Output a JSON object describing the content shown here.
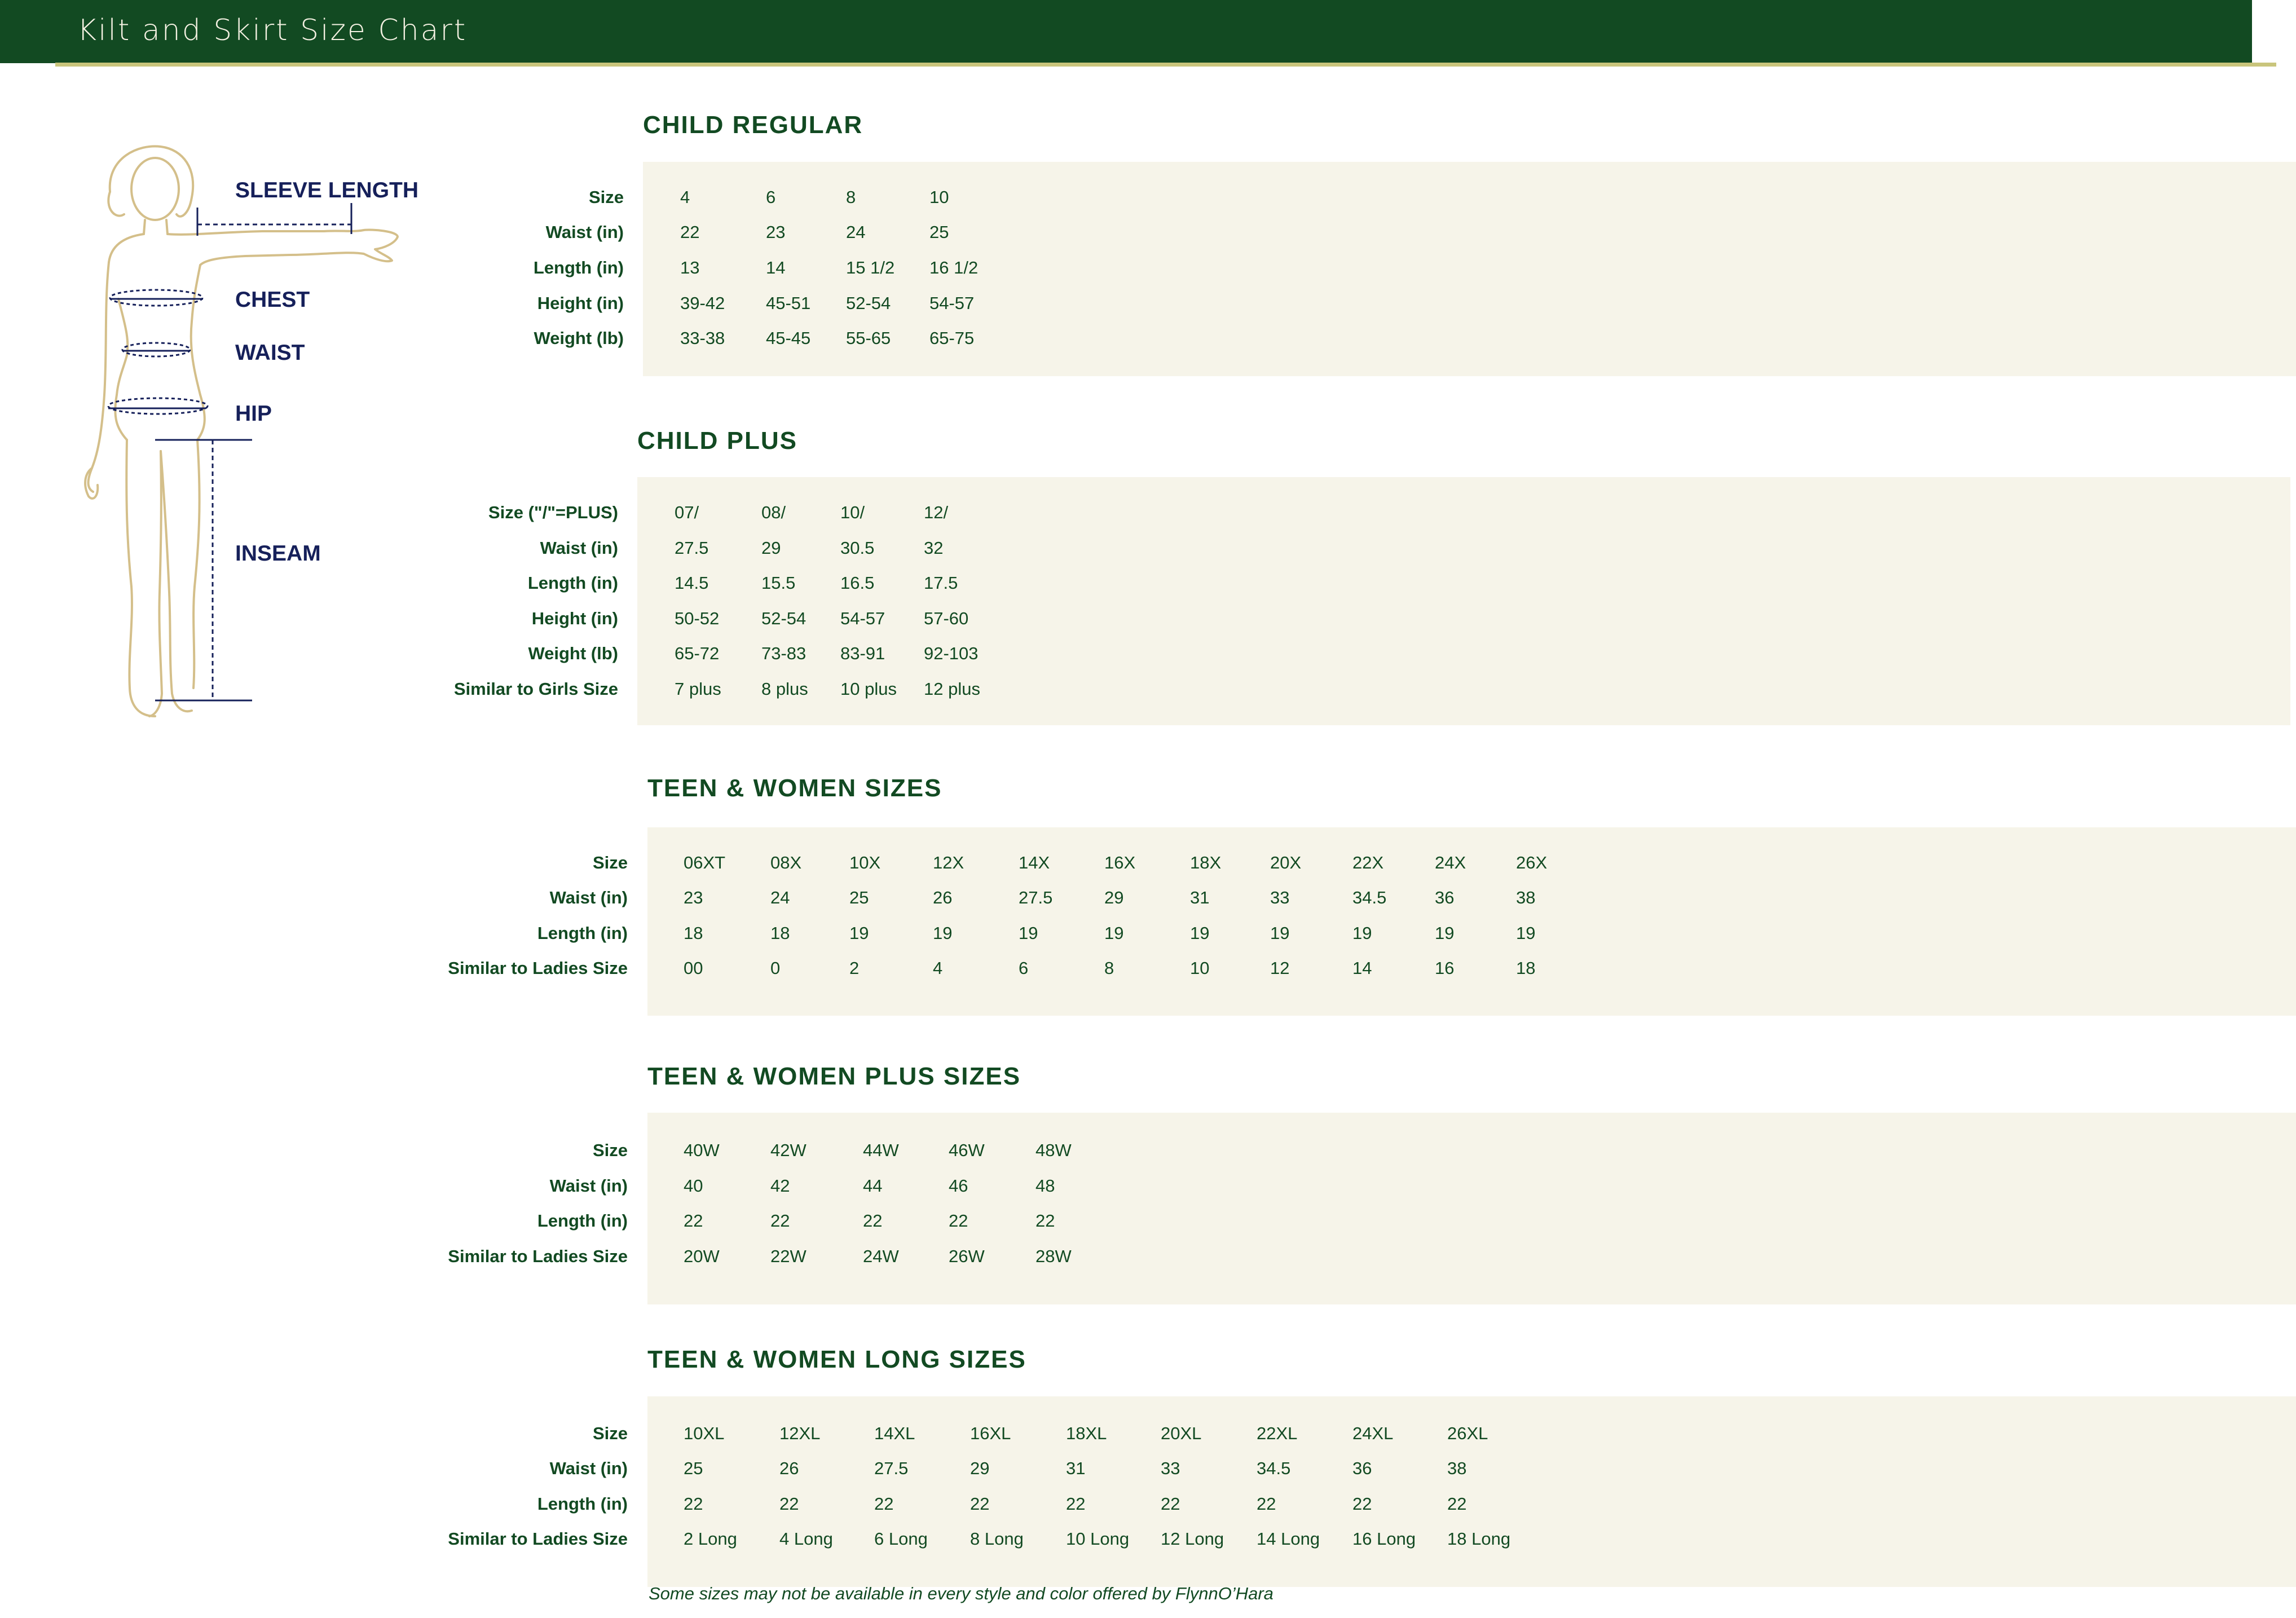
{
  "header": {
    "title": "Kilt and Skirt Size Chart"
  },
  "figure": {
    "labels": {
      "sleeve": "SLEEVE LENGTH",
      "chest": "CHEST",
      "waist": "WAIST",
      "hip": "HIP",
      "inseam": "INSEAM"
    }
  },
  "sections": [
    {
      "title": "CHILD  REGULAR",
      "rows": [
        {
          "label": "Size",
          "values": [
            "4",
            "6",
            "8",
            "10"
          ]
        },
        {
          "label": "Waist (in)",
          "values": [
            "22",
            "23",
            "24",
            "25"
          ]
        },
        {
          "label": "Length (in)",
          "values": [
            "13",
            "14",
            "15 1/2",
            "16 1/2"
          ]
        },
        {
          "label": "Height (in)",
          "values": [
            "39-42",
            "45-51",
            "52-54",
            "54-57"
          ]
        },
        {
          "label": "Weight (lb)",
          "values": [
            "33-38",
            "45-45",
            "55-65",
            "65-75"
          ]
        }
      ]
    },
    {
      "title": "CHILD PLUS",
      "rows": [
        {
          "label": "Size (\"/\"=PLUS)",
          "values": [
            "07/",
            "08/",
            "10/",
            "12/"
          ]
        },
        {
          "label": "Waist (in)",
          "values": [
            "27.5",
            "29",
            "30.5",
            "32"
          ]
        },
        {
          "label": "Length (in)",
          "values": [
            "14.5",
            "15.5",
            "16.5",
            "17.5"
          ]
        },
        {
          "label": "Height (in)",
          "values": [
            "50-52",
            "52-54",
            "54-57",
            "57-60"
          ]
        },
        {
          "label": "Weight (lb)",
          "values": [
            "65-72",
            "73-83",
            "83-91",
            "92-103"
          ]
        },
        {
          "label": "Similar to Girls Size",
          "values": [
            "7 plus",
            "8 plus",
            "10 plus",
            "12 plus"
          ]
        }
      ]
    },
    {
      "title": "TEEN & WOMEN SIZES",
      "rows": [
        {
          "label": "Size",
          "values": [
            "06XT",
            "08X",
            "10X",
            "12X",
            "14X",
            "16X",
            "18X",
            "20X",
            "22X",
            "24X",
            "26X"
          ]
        },
        {
          "label": "Waist (in)",
          "values": [
            "23",
            "24",
            "25",
            "26",
            "27.5",
            "29",
            "31",
            "33",
            "34.5",
            "36",
            "38"
          ]
        },
        {
          "label": "Length (in)",
          "values": [
            "18",
            "18",
            "19",
            "19",
            "19",
            "19",
            "19",
            "19",
            "19",
            "19",
            "19"
          ]
        },
        {
          "label": "Similar to Ladies Size",
          "values": [
            "00",
            "0",
            "2",
            "4",
            "6",
            "8",
            "10",
            "12",
            "14",
            "16",
            "18"
          ]
        }
      ]
    },
    {
      "title": "TEEN & WOMEN PLUS SIZES",
      "rows": [
        {
          "label": "Size",
          "values": [
            "40W",
            "42W",
            "44W",
            "46W",
            "48W"
          ]
        },
        {
          "label": "Waist (in)",
          "values": [
            "40",
            "42",
            "44",
            "46",
            "48"
          ]
        },
        {
          "label": "Length (in)",
          "values": [
            "22",
            "22",
            "22",
            "22",
            "22"
          ]
        },
        {
          "label": "Similar to Ladies Size",
          "values": [
            "20W",
            "22W",
            "24W",
            "26W",
            "28W"
          ]
        }
      ]
    },
    {
      "title": "TEEN & WOMEN LONG SIZES",
      "rows": [
        {
          "label": "Size",
          "values": [
            "10XL",
            "12XL",
            "14XL",
            "16XL",
            "18XL",
            "20XL",
            "22XL",
            "24XL",
            "26XL"
          ]
        },
        {
          "label": "Waist (in)",
          "values": [
            "25",
            "26",
            "27.5",
            "29",
            "31",
            "33",
            "34.5",
            "36",
            "38"
          ]
        },
        {
          "label": "Length (in)",
          "values": [
            "22",
            "22",
            "22",
            "22",
            "22",
            "22",
            "22",
            "22",
            "22"
          ]
        },
        {
          "label": "Similar to Ladies Size",
          "values": [
            "2 Long",
            "4 Long",
            "6 Long",
            "8 Long",
            "10 Long",
            "12 Long",
            "14 Long",
            "16 Long",
            "18 Long"
          ]
        }
      ]
    }
  ],
  "footnote": "Some sizes may not be available in every style and color offered by FlynnO’Hara",
  "colors": {
    "header_bg": "#124a22",
    "accent_rule": "#c9c57c",
    "panel_bg": "#f6f4e9",
    "text_green": "#124a22",
    "figure_label": "#16205a",
    "figure_outline": "#d4bf8a"
  }
}
